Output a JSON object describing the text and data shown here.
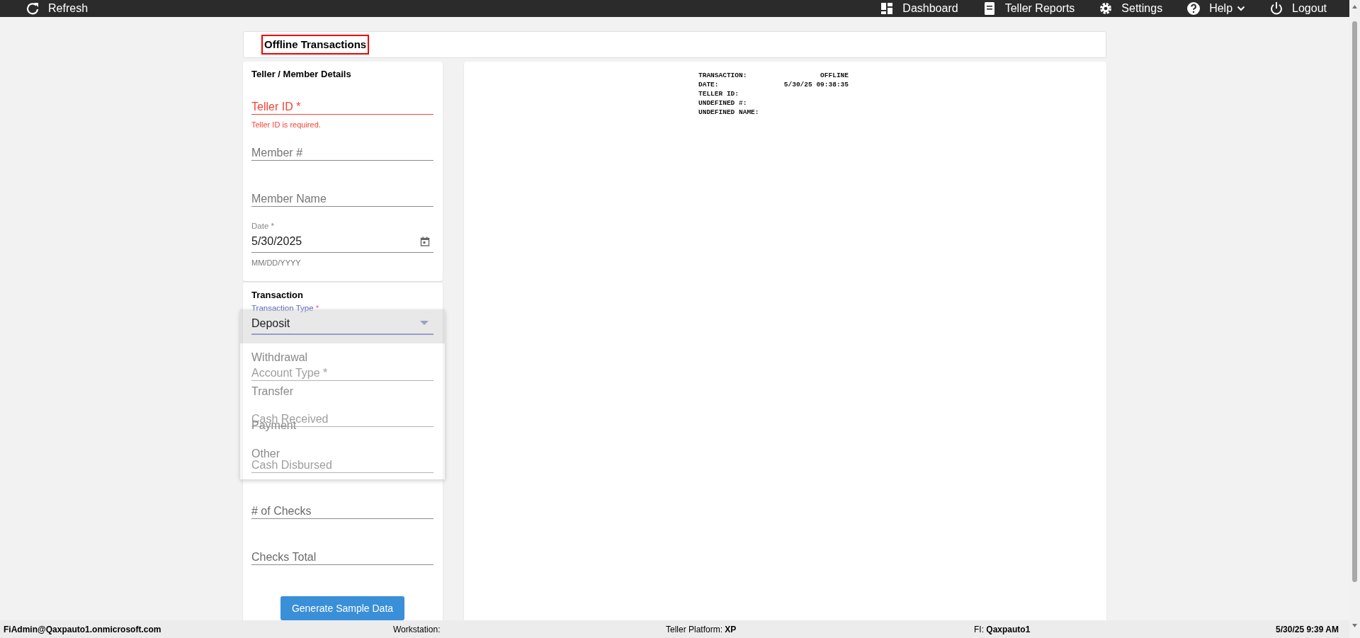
{
  "top_bar": {
    "left": [
      {
        "kind": "refresh",
        "label": "Refresh"
      }
    ],
    "right": [
      {
        "kind": "dashboard",
        "label": "Dashboard",
        "dropdown": false
      },
      {
        "kind": "reports",
        "label": "Teller Reports",
        "dropdown": false
      },
      {
        "kind": "settings",
        "label": "Settings",
        "dropdown": false
      },
      {
        "kind": "help",
        "label": "Help",
        "dropdown": true
      },
      {
        "kind": "logout",
        "label": "Logout",
        "dropdown": false
      }
    ]
  },
  "page_title": "Offline Transactions",
  "sections": [
    {
      "title": "Teller / Member Details",
      "fields": [
        {
          "kind": "text",
          "placeholder": "Teller ID *",
          "error": true,
          "error_text": "Teller ID is required."
        },
        {
          "kind": "text",
          "placeholder": "Member #",
          "error": false
        },
        {
          "kind": "text",
          "placeholder": "Member Name",
          "error": false
        },
        {
          "kind": "date",
          "label": "Date *",
          "value": "5/30/2025",
          "hint": "MM/DD/YYYY",
          "error": false
        }
      ]
    },
    {
      "title": "Transaction",
      "fields": [
        {
          "kind": "select",
          "label": "Transaction Type",
          "required_mark": "*",
          "focused": true,
          "error": false
        },
        {
          "kind": "text",
          "placeholder": "Account Type *",
          "error": false
        },
        {
          "kind": "text",
          "placeholder": "Cash Received",
          "error": false
        },
        {
          "kind": "text",
          "placeholder": "Cash Disbursed",
          "error": false
        },
        {
          "kind": "text",
          "placeholder": "# of Checks",
          "error": false
        },
        {
          "kind": "text",
          "placeholder": "Checks Total",
          "error": false
        }
      ],
      "dropdown": {
        "options": [
          {
            "label": "Deposit",
            "selected": true
          },
          {
            "label": "Withdrawal",
            "selected": false
          },
          {
            "label": "Transfer",
            "selected": false
          },
          {
            "label": "Payment",
            "selected": false
          },
          {
            "label": "Other",
            "selected": false
          }
        ]
      },
      "button": "Generate Sample Data"
    }
  ],
  "receipt": {
    "lines": [
      {
        "label": "TRANSACTION:",
        "value": "OFFLINE"
      },
      {
        "label": "DATE:",
        "value": "5/30/25 09:38:35"
      },
      {
        "label": "TELLER ID:"
      },
      {
        "label": "UNDEFINED #:"
      },
      {
        "label": "UNDEFINED NAME:"
      }
    ]
  },
  "status_bar": {
    "user": "FiAdmin@Qaxpauto1.onmicrosoft.com",
    "workstation": "Workstation:",
    "platform": "Teller Platform: **XP**",
    "fi": "FI: **Qaxpauto1**",
    "datetime": "5/30/25 9:39 AM"
  }
}
